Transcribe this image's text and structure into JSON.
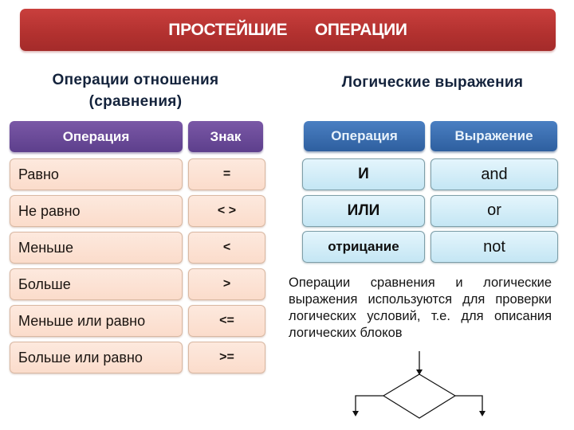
{
  "title": "ПРОСТЕЙШИЕ   ОПЕРАЦИИ",
  "comparison": {
    "title_line1": "Операции отношения",
    "title_line2": "(сравнения)",
    "headers": {
      "operation": "Операция",
      "sign": "Знак"
    },
    "rows": [
      {
        "operation": "Равно",
        "sign": "="
      },
      {
        "operation": "Не равно",
        "sign": "< >"
      },
      {
        "operation": "Меньше",
        "sign": "<"
      },
      {
        "operation": "Больше",
        "sign": ">"
      },
      {
        "operation": "Меньше или равно",
        "sign": "<="
      },
      {
        "operation": "Больше или равно",
        "sign": ">="
      }
    ]
  },
  "logical": {
    "title": "Логические выражения",
    "headers": {
      "operation": "Операция",
      "expression": "Выражение"
    },
    "rows": [
      {
        "operation": "И",
        "expression": "and"
      },
      {
        "operation": "ИЛИ",
        "expression": "or"
      },
      {
        "operation": "отрицание",
        "expression": "not"
      }
    ]
  },
  "description": "Операции сравнения и логические выражения используются для проверки логических условий, т.е. для описания логических блоков",
  "flowchart": {
    "shape": "decision-diamond",
    "branches": [
      "left",
      "right"
    ]
  },
  "colors": {
    "title_bar": "#b2312f",
    "comparison_header": "#6a4b98",
    "comparison_cell": "#fce2d4",
    "logical_header": "#3b6fb0",
    "logical_cell": "#d3edf8"
  }
}
